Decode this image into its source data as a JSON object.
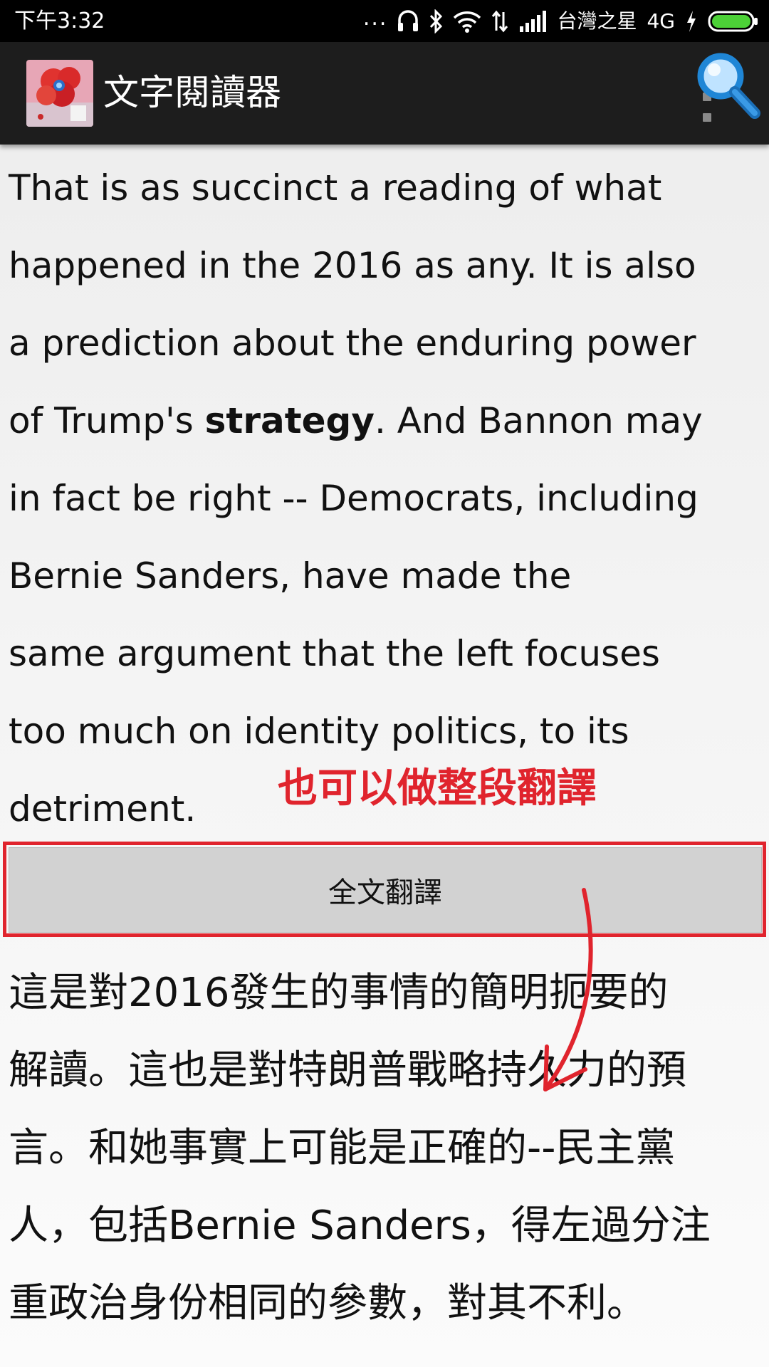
{
  "status_bar": {
    "time": "下午3:32",
    "dots": "...",
    "carrier": "台灣之星",
    "network": "4G"
  },
  "app_bar": {
    "title": "文字閱讀器"
  },
  "content": {
    "english_lines": [
      "That is as succinct a reading of what",
      "happened in the 2016 as any. It is also",
      "a prediction about the enduring power",
      [
        "of Trump's ",
        "strategy",
        ". And Bannon may"
      ],
      "in fact be right -- Democrats, including",
      "Bernie Sanders, have made the",
      "same argument that the left focuses",
      "too much on identity politics, to its",
      "detriment."
    ],
    "annotation": "也可以做整段翻譯",
    "translate_button_label": "全文翻譯",
    "chinese_lines": [
      "這是對2016發生的事情的簡明扼要的",
      "解讀。這也是對特朗普戰略持久力的預",
      "言。和她事實上可能是正確的--民主黨",
      "人，包括Bernie Sanders，得左過分注",
      "重政治身份相同的參數，對其不利。"
    ]
  },
  "colors": {
    "annotation_red": "#e0242d",
    "search_blue": "#1f86d6",
    "app_bar_bg": "#1d1d1d"
  },
  "icons": [
    "headset-icon",
    "bluetooth-icon",
    "wifi-icon",
    "data-arrows-icon",
    "signal-icon",
    "charging-icon",
    "battery-icon",
    "app-logo-icon",
    "search-icon",
    "overflow-menu-icon",
    "annotation-arrow"
  ]
}
